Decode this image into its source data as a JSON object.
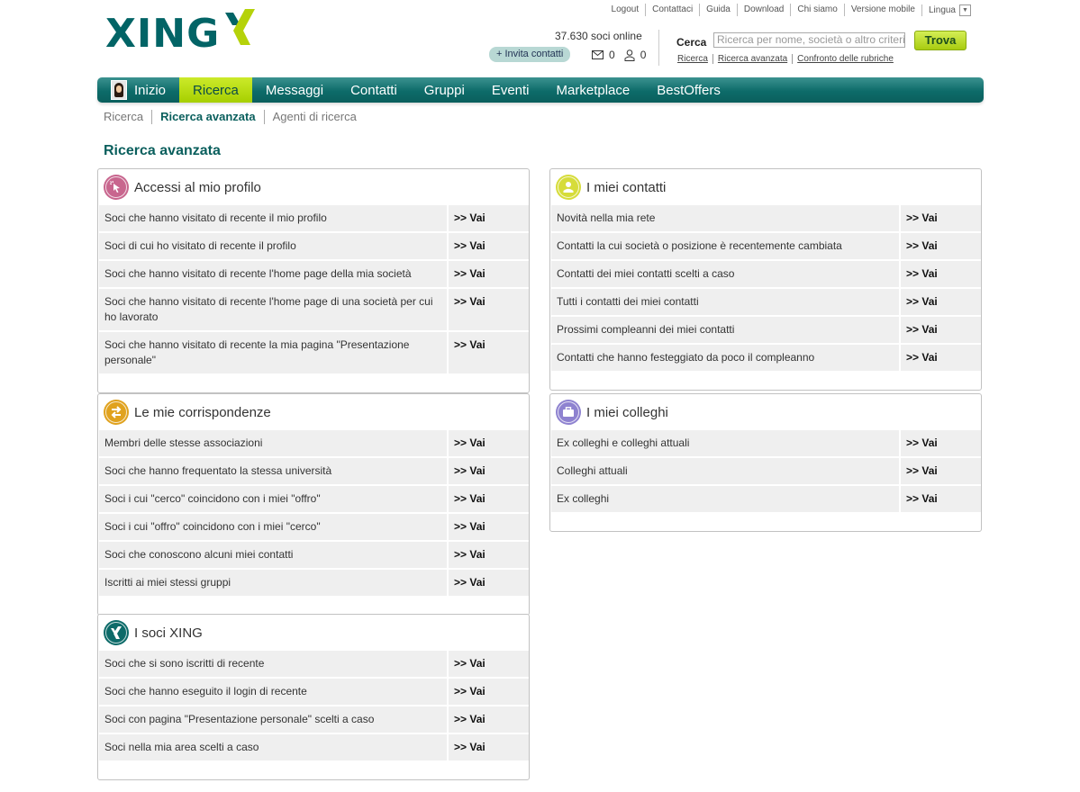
{
  "toplinks": [
    "Logout",
    "Contattaci",
    "Guida",
    "Download",
    "Chi siamo",
    "Versione mobile"
  ],
  "lingua": "Lingua",
  "logo": "XING",
  "online": "37.630 soci online",
  "invite": "+ Invita contatti",
  "messages_count": "0",
  "contacts_count": "0",
  "search": {
    "label": "Cerca",
    "placeholder": "Ricerca per nome, società o altro criterio",
    "button": "Trova",
    "links": [
      "Ricerca",
      "Ricerca avanzata",
      "Confronto delle rubriche"
    ]
  },
  "nav": [
    "Inizio",
    "Ricerca",
    "Messaggi",
    "Contatti",
    "Gruppi",
    "Eventi",
    "Marketplace",
    "BestOffers"
  ],
  "subnav": [
    "Ricerca",
    "Ricerca avanzata",
    "Agenti di ricerca"
  ],
  "page_title": "Ricerca avanzata",
  "vai": ">> Vai",
  "colors": {
    "brand": "#026466",
    "accent": "#a6cf00"
  },
  "boxes": {
    "accessi": {
      "title": "Accessi al mio profilo",
      "icon": "cursor-click-icon",
      "rows": [
        "Soci che hanno visitato di recente il mio profilo",
        "Soci di cui ho visitato di recente il profilo",
        "Soci che hanno visitato di recente l'home page della mia società",
        "Soci che hanno visitato di recente l'home page di una società per cui ho lavorato",
        "Soci che hanno visitato di recente la mia pagina \"Presentazione personale\""
      ]
    },
    "contatti": {
      "title": "I miei contatti",
      "icon": "person-icon",
      "rows": [
        "Novità nella mia rete",
        "Contatti la cui società o posizione è recentemente cambiata",
        "Contatti dei miei contatti scelti a caso",
        "Tutti i contatti dei miei contatti",
        "Prossimi compleanni dei miei contatti",
        "Contatti che hanno festeggiato da poco il compleanno"
      ]
    },
    "corrispondenze": {
      "title": "Le mie corrispondenze",
      "icon": "exchange-arrows-icon",
      "rows": [
        "Membri delle stesse associazioni",
        "Soci che hanno frequentato la stessa università",
        "Soci i cui \"cerco\" coincidono con i miei \"offro\"",
        "Soci i cui \"offro\" coincidono con i miei \"cerco\"",
        "Soci che conoscono alcuni miei contatti",
        "Iscritti ai miei stessi gruppi"
      ]
    },
    "colleghi": {
      "title": "I miei colleghi",
      "icon": "briefcase-icon",
      "rows": [
        "Ex colleghi e colleghi attuali",
        "Colleghi attuali",
        "Ex colleghi"
      ]
    },
    "soci": {
      "title": "I soci XING",
      "icon": "xing-logo-icon",
      "rows": [
        "Soci che si sono iscritti di recente",
        "Soci che hanno eseguito il login di recente",
        "Soci con pagina \"Presentazione personale\" scelti a caso",
        "Soci nella mia area scelti a caso"
      ]
    }
  }
}
